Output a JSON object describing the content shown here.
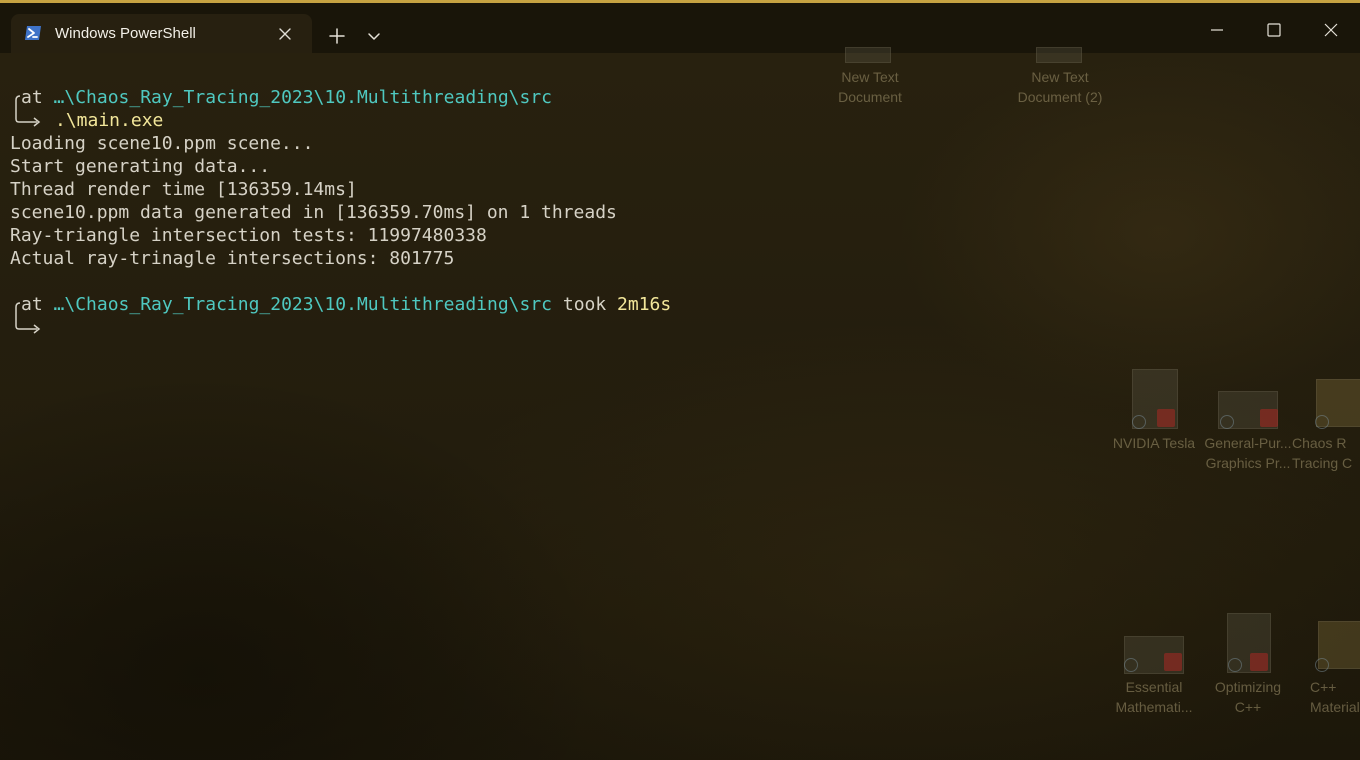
{
  "window": {
    "tab_title": "Windows PowerShell",
    "icons": {
      "tab": "powershell-icon",
      "tab_close": "close-icon",
      "new_tab": "plus-icon",
      "dropdown": "chevron-down-icon",
      "minimize": "minimize-icon",
      "maximize": "maximize-icon",
      "close": "close-icon"
    }
  },
  "terminal": {
    "prompt1": {
      "prefix": "at ",
      "path": "…\\Chaos_Ray_Tracing_2023\\10.Multithreading\\src",
      "command": ".\\main.exe"
    },
    "output": [
      "Loading scene10.ppm scene...",
      "Start generating data...",
      "Thread render time [136359.14ms]",
      "scene10.ppm data generated in [136359.70ms] on 1 threads",
      "Ray-triangle intersection tests: 11997480338",
      "Actual ray-trinagle intersections: 801775"
    ],
    "prompt2": {
      "prefix": "at ",
      "path": "…\\Chaos_Ray_Tracing_2023\\10.Multithreading\\src",
      "took_label": " took ",
      "took_value": "2m16s"
    }
  },
  "desktop_icons": [
    {
      "label": "New Text\nDocument"
    },
    {
      "label": "New Text\nDocument (2)"
    },
    {
      "label": "NVIDIA Tesla"
    },
    {
      "label": "General-Pur...\nGraphics Pr..."
    },
    {
      "label": "Chaos R\nTracing C"
    },
    {
      "label": "Essential\nMathemati..."
    },
    {
      "label": "Optimizing\nC++"
    },
    {
      "label": "C++\nMaterial"
    }
  ],
  "colors": {
    "accent_border": "#c6a342",
    "path": "#4fc8c0",
    "command": "#f2e69a",
    "text": "#d6d2c6"
  }
}
